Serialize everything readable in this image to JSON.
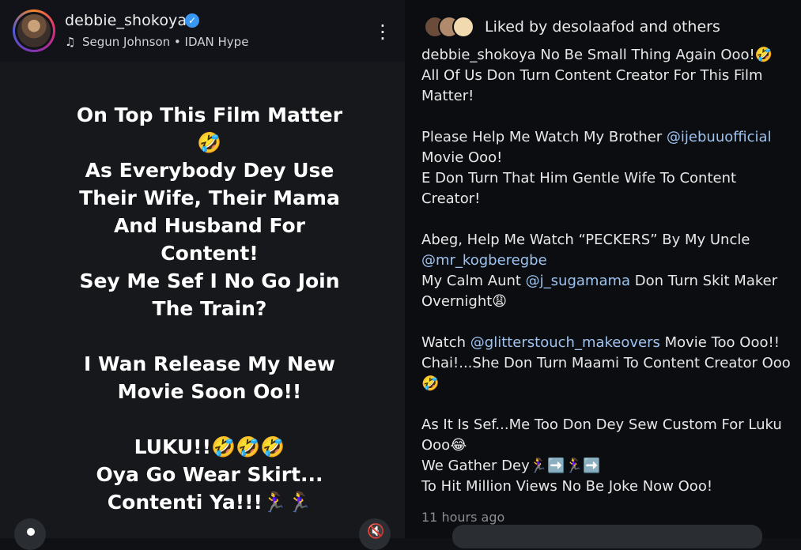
{
  "header": {
    "username": "debbie_shokoya",
    "music": "Segun Johnson • IDAN Hype",
    "verified_icon": "verified-badge-icon",
    "more_icon": "more-vertical-icon"
  },
  "post": {
    "lines": [
      "On Top This Film Matter",
      "🤣",
      "As Everybody Dey Use",
      "Their Wife, Their Mama",
      "And Husband For",
      "Content!",
      "Sey Me Sef I No Go Join",
      "The Train?",
      "",
      "I Wan Release My New",
      "Movie Soon Oo!!",
      "",
      "LUKU!!🤣🤣🤣",
      "Oya Go Wear Skirt...",
      "Contenti Ya!!!🏃‍♀️🏃‍♀️"
    ]
  },
  "likes": {
    "text": "Liked by desolaafod and others",
    "avatar_colors": [
      "#6b4c3b",
      "#b08a6a",
      "#f1d9b0"
    ]
  },
  "caption": {
    "l1": "debbie_shokoya No Be Small Thing Again Ooo!🤣",
    "l2": "All Of Us Don Turn Content Creator For This Film",
    "l3": "Matter!",
    "l4_a": "Please Help Me Watch My Brother ",
    "l4_mention": "@ijebuuofficial",
    "l5": "Movie Ooo!",
    "l6": "E Don Turn That Him Gentle Wife To Content",
    "l7": "Creator!",
    "l8": "Abeg, Help Me Watch “PECKERS” By My Uncle",
    "l9_mention": "@mr_kogberegbe",
    "l10_a": "My Calm Aunt ",
    "l10_mention": "@j_sugamama",
    "l10_b": " Don Turn Skit Maker",
    "l11": "Overnight😩",
    "l12_a": "Watch ",
    "l12_mention": "@glitterstouch_makeovers",
    "l12_b": " Movie Too Ooo!!",
    "l13": "Chai!...She Don Turn Maami To Content Creator Ooo",
    "l14": "🤣",
    "l15": "As It Is Sef...Me Too Don Dey Sew Custom For Luku",
    "l16": "Ooo😂",
    "l17": "We Gather Dey🏃‍♀️➡️🏃‍♀️➡️",
    "l18": "To Hit Million Views No Be Joke Now Ooo!"
  },
  "timestamp": "11 hours ago",
  "colors": {
    "left_bg": "#16181c",
    "right_bg": "#0b0d10",
    "mention": "#9ec3ef",
    "verified": "#3897f0"
  }
}
